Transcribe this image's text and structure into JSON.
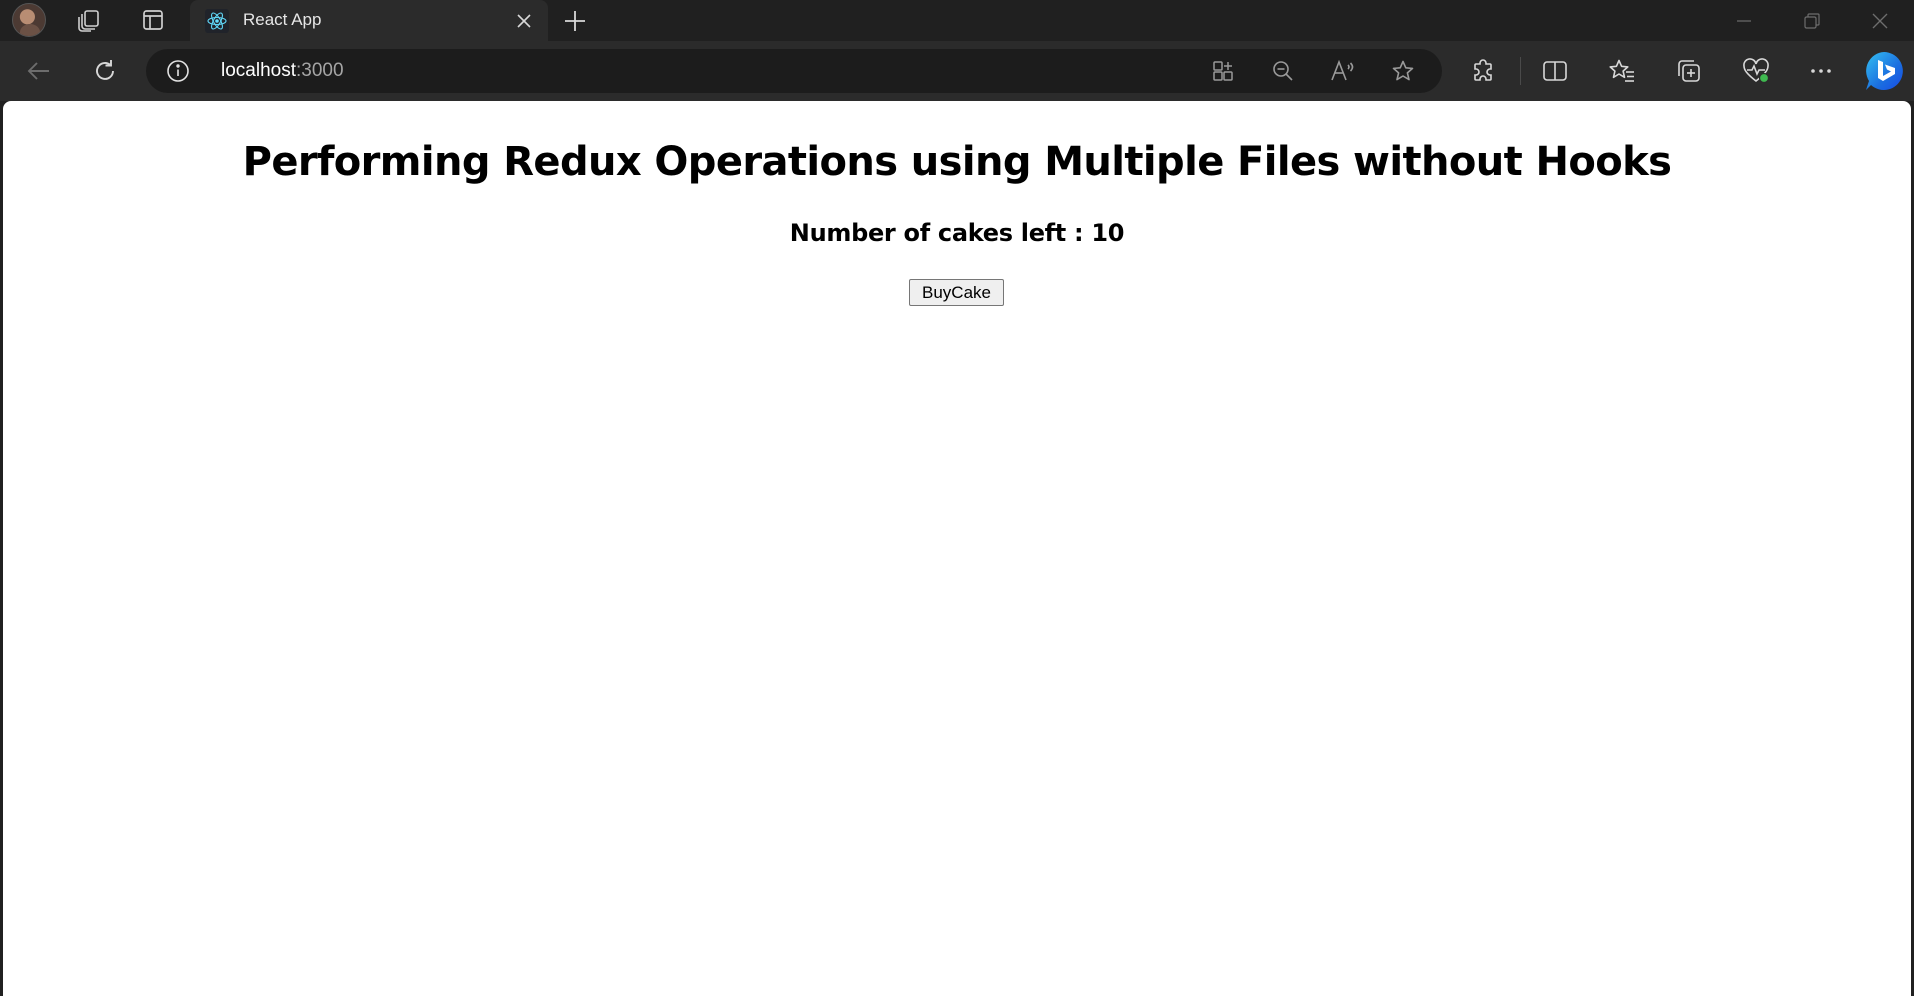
{
  "browser": {
    "tab": {
      "title": "React App",
      "favicon": "react-logo-icon"
    },
    "address_bar": {
      "host": "localhost",
      "port": ":3000"
    },
    "icons": {
      "profile": "avatar",
      "workspaces": "workspaces-icon",
      "tab_actions": "vertical-tabs-icon",
      "close_tab": "close-icon",
      "new_tab": "plus-icon",
      "back": "back-arrow-icon",
      "refresh": "refresh-icon",
      "site_info": "info-icon",
      "app_available": "apps-icon",
      "zoom": "zoom-out-icon",
      "read_aloud": "read-aloud-icon",
      "favorite": "star-icon",
      "extensions": "puzzle-icon",
      "split_screen": "split-screen-icon",
      "favorites": "favorites-icon",
      "collections": "collections-icon",
      "browser_essentials": "heartbeat-icon",
      "more": "more-icon",
      "copilot": "bing-copilot-icon"
    },
    "colors": {
      "chrome_dark": "#202020",
      "toolbar": "#2b2b2b",
      "react_blue": "#61dafb"
    }
  },
  "page": {
    "title": "Performing Redux Operations using Multiple Files without Hooks",
    "cakes_label": "Number of cakes left : 10",
    "buy_button_label": "BuyCake"
  }
}
